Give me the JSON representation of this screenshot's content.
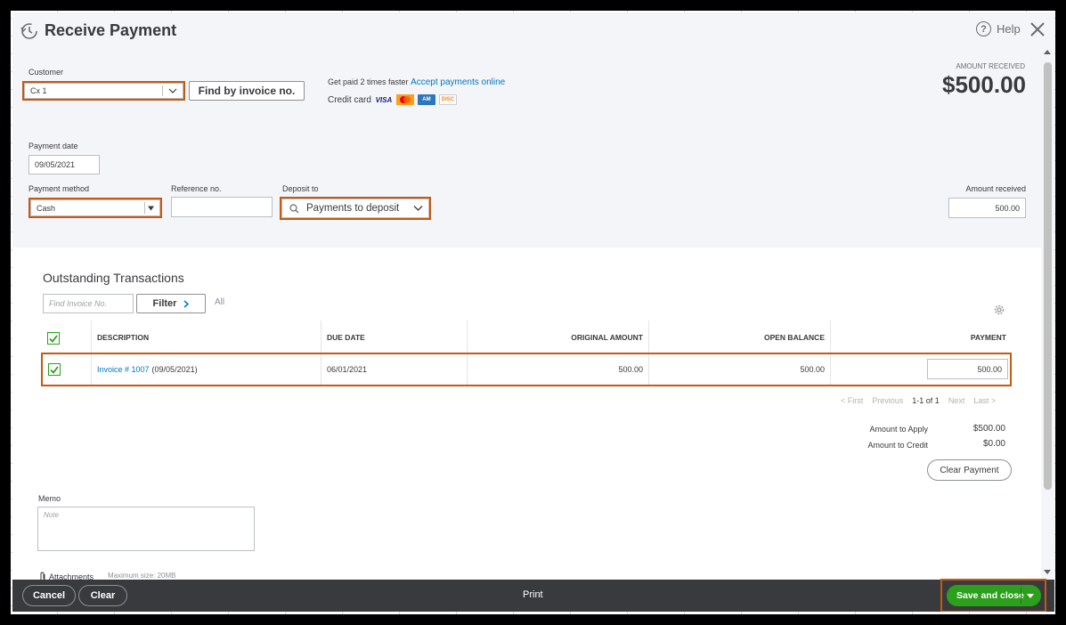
{
  "header": {
    "title": "Receive Payment",
    "help_label": "Help"
  },
  "customer": {
    "label": "Customer",
    "value": "Cx 1",
    "find_invoice_button": "Find by invoice no."
  },
  "online_payments": {
    "prefix": "Get paid 2 times faster",
    "link": "Accept payments online",
    "credit_card_label": "Credit card",
    "cards": [
      "VISA",
      "MC",
      "AMEX",
      "DISC"
    ]
  },
  "amount_received_summary": {
    "caption": "AMOUNT RECEIVED",
    "value": "$500.00"
  },
  "payment_date": {
    "label": "Payment date",
    "value": "09/05/2021"
  },
  "payment_method": {
    "label": "Payment method",
    "value": "Cash"
  },
  "reference": {
    "label": "Reference no.",
    "value": ""
  },
  "deposit_to": {
    "label": "Deposit to",
    "value": "Payments to deposit"
  },
  "amount_received_field": {
    "label": "Amount received",
    "value": "500.00"
  },
  "outstanding": {
    "title": "Outstanding Transactions",
    "find_placeholder": "Find Invoice No.",
    "filter_label": "Filter",
    "all_label": "All",
    "columns": [
      "DESCRIPTION",
      "DUE DATE",
      "ORIGINAL AMOUNT",
      "OPEN BALANCE",
      "PAYMENT"
    ],
    "rows": [
      {
        "invoice_link": "Invoice # 1007",
        "invoice_date": "(09/05/2021)",
        "due_date": "06/01/2021",
        "original_amount": "500.00",
        "open_balance": "500.00",
        "payment": "500.00",
        "checked": true
      }
    ],
    "pager": {
      "first": "< First",
      "previous": "Previous",
      "range": "1-1 of 1",
      "next": "Next",
      "last": "Last >"
    }
  },
  "totals": {
    "apply_label": "Amount to Apply",
    "apply_value": "$500.00",
    "credit_label": "Amount to Credit",
    "credit_value": "$0.00",
    "clear_payment_label": "Clear Payment"
  },
  "memo": {
    "label": "Memo",
    "placeholder": "Note"
  },
  "attachments": {
    "label": "Attachments",
    "note": "Maximum size: 20MB"
  },
  "footer": {
    "cancel_label": "Cancel",
    "clear_label": "Clear",
    "print_label": "Print",
    "save_label": "Save and close"
  },
  "colors": {
    "accent_green": "#2ca01c",
    "link_blue": "#0077c5",
    "highlight_orange": "#c55a11",
    "footer_bg": "#393a3d"
  }
}
